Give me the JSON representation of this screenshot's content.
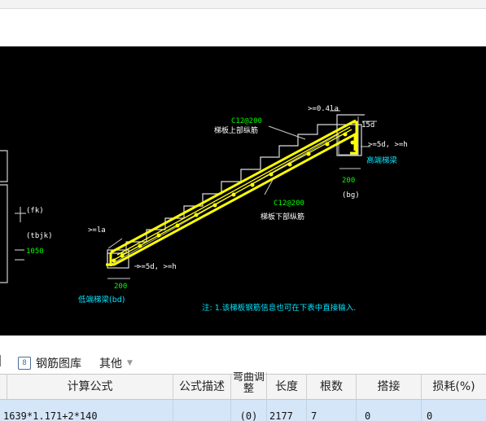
{
  "drawing": {
    "top_rebar_label": "C12@200",
    "top_rebar_name": "梯板上部纵筋",
    "bottom_rebar_label": "C12@200",
    "bottom_rebar_name": "梯板下部纵筋",
    "dim_top_right": ">=0.4la",
    "dim_15d": "15d",
    "dim_right_anchor": ">=5d, >=h",
    "high_beam": "高端梯梁",
    "dim_right_200": "200",
    "dim_right_bg": "(bg)",
    "dim_left_la": ">=la",
    "dim_left_anchor": ">=5d, >=h",
    "dim_left_200": "200",
    "low_beam": "低端梯梁(bd)",
    "left_fk": "(fk)",
    "left_tbjk": "(tbjk)",
    "left_1050": "1050",
    "note": "注: 1.该梯板钢筋信息也可在下表中直接输入."
  },
  "toolbar": {
    "rebar_library_icon": "rebar-library-icon",
    "rebar_library": "钢筋图库",
    "other": "其他"
  },
  "table": {
    "headers": {
      "formula": "计算公式",
      "formula_desc": "公式描述",
      "bend_adjust": "弯曲调整",
      "length": "长度",
      "count": "根数",
      "overlap": "搭接",
      "loss": "损耗(%)"
    },
    "row": {
      "formula": "1639*1.171+2*140",
      "formula_desc": "",
      "bend_adjust": "(0)",
      "length": "2177",
      "count": "7",
      "overlap": "0",
      "loss": "0"
    }
  },
  "colors": {
    "rebar": "#ffff00",
    "label_green": "#00ff00",
    "dim_cyan": "#00e5ff",
    "selected_row": "#d5e6f8"
  }
}
